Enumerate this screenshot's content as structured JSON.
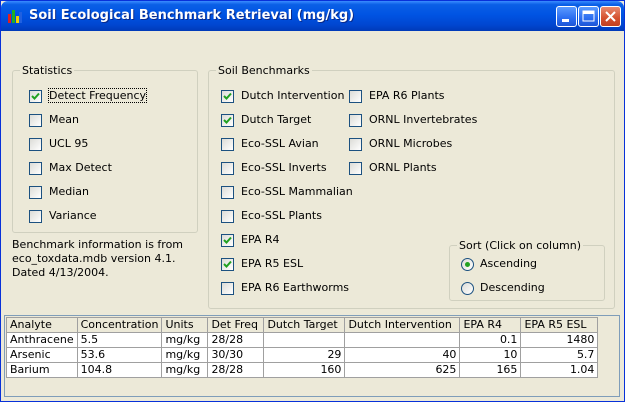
{
  "window": {
    "title": "Soil Ecological Benchmark Retrieval (mg/kg)"
  },
  "statistics": {
    "legend": "Statistics",
    "items": [
      {
        "label": "Detect Frequency",
        "checked": true
      },
      {
        "label": "Mean",
        "checked": false
      },
      {
        "label": "UCL 95",
        "checked": false
      },
      {
        "label": "Max Detect",
        "checked": false
      },
      {
        "label": "Median",
        "checked": false
      },
      {
        "label": "Variance",
        "checked": false
      }
    ]
  },
  "benchmarks": {
    "legend": "Soil Benchmarks",
    "col1": [
      {
        "label": "Dutch Intervention",
        "checked": true
      },
      {
        "label": "Dutch Target",
        "checked": true
      },
      {
        "label": "Eco-SSL Avian",
        "checked": false
      },
      {
        "label": "Eco-SSL Inverts",
        "checked": false
      },
      {
        "label": "Eco-SSL Mammalian",
        "checked": false
      },
      {
        "label": "Eco-SSL Plants",
        "checked": false
      },
      {
        "label": "EPA R4",
        "checked": true
      },
      {
        "label": "EPA R5 ESL",
        "checked": true
      },
      {
        "label": "EPA R6 Earthworms",
        "checked": false
      }
    ],
    "col2": [
      {
        "label": "EPA R6 Plants",
        "checked": false
      },
      {
        "label": "ORNL Invertebrates",
        "checked": false
      },
      {
        "label": "ORNL Microbes",
        "checked": false
      },
      {
        "label": "ORNL Plants",
        "checked": false
      }
    ]
  },
  "info_text": "Benchmark information is from eco_toxdata.mdb version 4.1. Dated 4/13/2004.",
  "sort": {
    "legend": "Sort (Click on column)",
    "options": [
      {
        "label": "Ascending",
        "selected": true
      },
      {
        "label": "Descending",
        "selected": false
      }
    ]
  },
  "grid": {
    "columns": [
      "Analyte",
      "Concentration",
      "Units",
      "Det Freq",
      "Dutch Target",
      "Dutch Intervention",
      "EPA R4",
      "EPA R5 ESL"
    ],
    "rows": [
      [
        "Anthracene",
        "5.5",
        "mg/kg",
        "28/28",
        "",
        "",
        "0.1",
        "1480"
      ],
      [
        "Arsenic",
        "53.6",
        "mg/kg",
        "30/30",
        "29",
        "40",
        "10",
        "5.7"
      ],
      [
        "Barium",
        "104.8",
        "mg/kg",
        "28/28",
        "160",
        "625",
        "165",
        "1.04"
      ]
    ]
  }
}
